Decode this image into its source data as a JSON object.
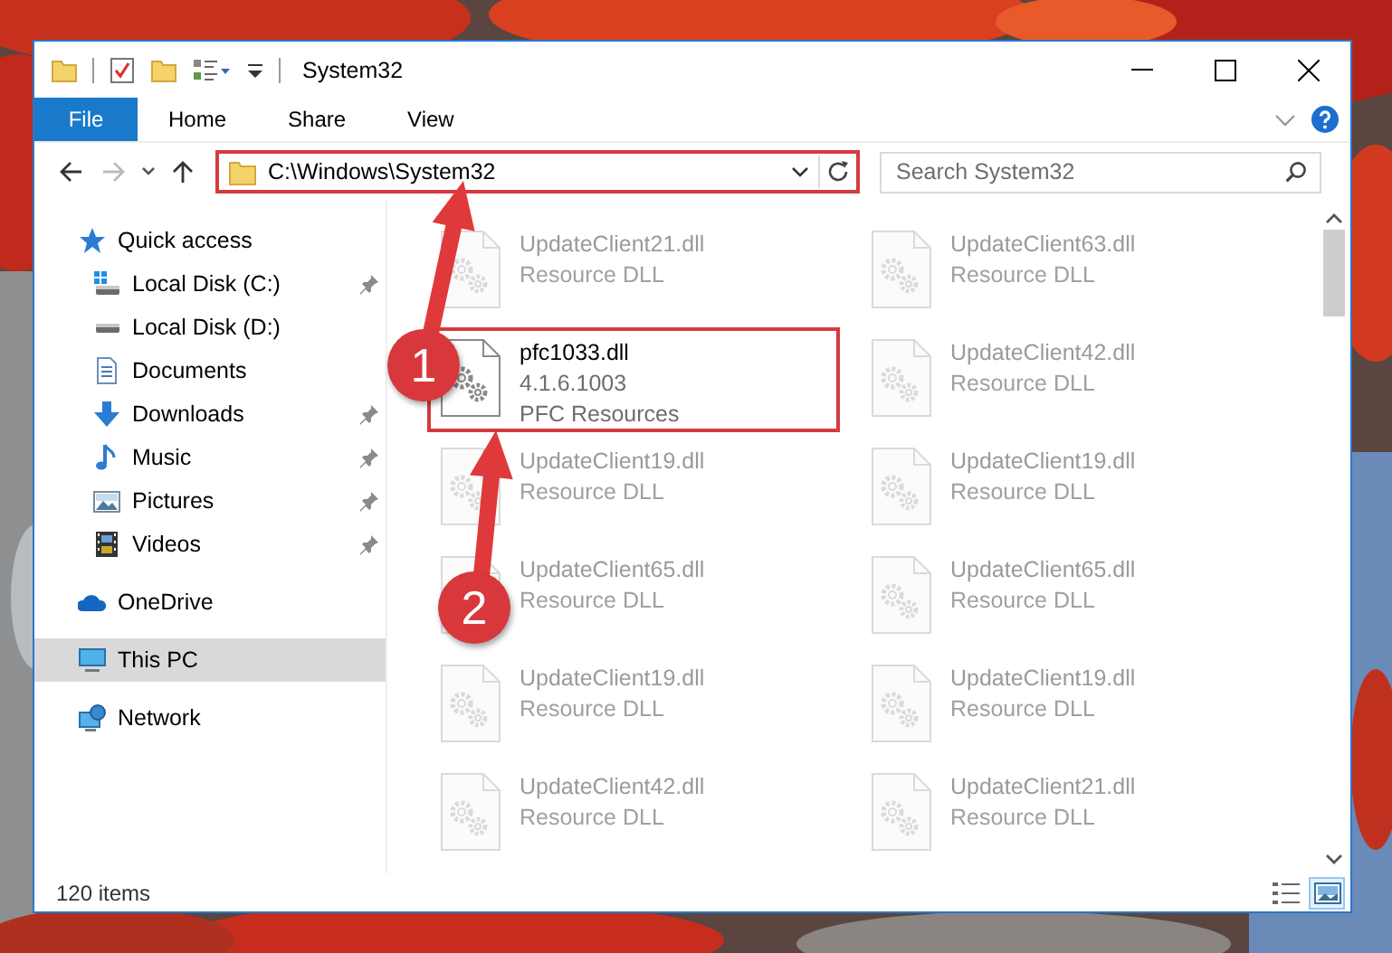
{
  "window": {
    "title": "System32"
  },
  "ribbon": {
    "tabs": [
      {
        "label": "File",
        "kind": "menu",
        "selected": false
      },
      {
        "label": "Home",
        "kind": "tab",
        "selected": false
      },
      {
        "label": "Share",
        "kind": "tab",
        "selected": false
      },
      {
        "label": "View",
        "kind": "tab",
        "selected": false
      }
    ]
  },
  "address_bar": {
    "path": "C:\\Windows\\System32",
    "highlighted": true
  },
  "search": {
    "placeholder": "Search System32"
  },
  "navigation_pane": {
    "items": [
      {
        "label": "Quick access",
        "kind": "quick-access",
        "selected": false,
        "children": [
          {
            "label": "Local Disk (C:)",
            "kind": "drive-c",
            "selected": false,
            "pinned": true
          },
          {
            "label": "Local Disk (D:)",
            "kind": "drive",
            "selected": false,
            "pinned": false
          },
          {
            "label": "Documents",
            "kind": "documents",
            "selected": false,
            "pinned": false
          },
          {
            "label": "Downloads",
            "kind": "downloads",
            "selected": false,
            "pinned": true
          },
          {
            "label": "Music",
            "kind": "music",
            "selected": false,
            "pinned": true
          },
          {
            "label": "Pictures",
            "kind": "pictures",
            "selected": false,
            "pinned": true
          },
          {
            "label": "Videos",
            "kind": "videos",
            "selected": false,
            "pinned": true
          }
        ]
      },
      {
        "label": "OneDrive",
        "kind": "onedrive",
        "selected": false
      },
      {
        "label": "This PC",
        "kind": "pc",
        "selected": true
      },
      {
        "label": "Network",
        "kind": "network",
        "selected": false
      }
    ]
  },
  "files": [
    {
      "name": "UpdateClient21.dll",
      "details": [
        "Resource DLL"
      ],
      "dimmed": true,
      "highlighted": false
    },
    {
      "name": "UpdateClient63.dll",
      "details": [
        "Resource DLL"
      ],
      "dimmed": true,
      "highlighted": false
    },
    {
      "name": "pfc1033.dll",
      "details": [
        "4.1.6.1003",
        "PFC Resources"
      ],
      "dimmed": false,
      "highlighted": true
    },
    {
      "name": "UpdateClient42.dll",
      "details": [
        "Resource DLL"
      ],
      "dimmed": true,
      "highlighted": false
    },
    {
      "name": "UpdateClient19.dll",
      "details": [
        "Resource DLL"
      ],
      "dimmed": true,
      "highlighted": false
    },
    {
      "name": "UpdateClient19.dll",
      "details": [
        "Resource DLL"
      ],
      "dimmed": true,
      "highlighted": false
    },
    {
      "name": "UpdateClient65.dll",
      "details": [
        "Resource DLL"
      ],
      "dimmed": true,
      "highlighted": false
    },
    {
      "name": "UpdateClient65.dll",
      "details": [
        "Resource DLL"
      ],
      "dimmed": true,
      "highlighted": false
    },
    {
      "name": "UpdateClient19.dll",
      "details": [
        "Resource DLL"
      ],
      "dimmed": true,
      "highlighted": false
    },
    {
      "name": "UpdateClient19.dll",
      "details": [
        "Resource DLL"
      ],
      "dimmed": true,
      "highlighted": false
    },
    {
      "name": "UpdateClient42.dll",
      "details": [
        "Resource DLL"
      ],
      "dimmed": true,
      "highlighted": false
    },
    {
      "name": "UpdateClient21.dll",
      "details": [
        "Resource DLL"
      ],
      "dimmed": true,
      "highlighted": false
    }
  ],
  "status_bar": {
    "item_count": "120 items",
    "view_buttons": [
      {
        "kind": "details",
        "selected": false
      },
      {
        "kind": "tiles",
        "selected": true
      }
    ]
  },
  "callouts": [
    {
      "number": "1"
    },
    {
      "number": "2"
    }
  ]
}
